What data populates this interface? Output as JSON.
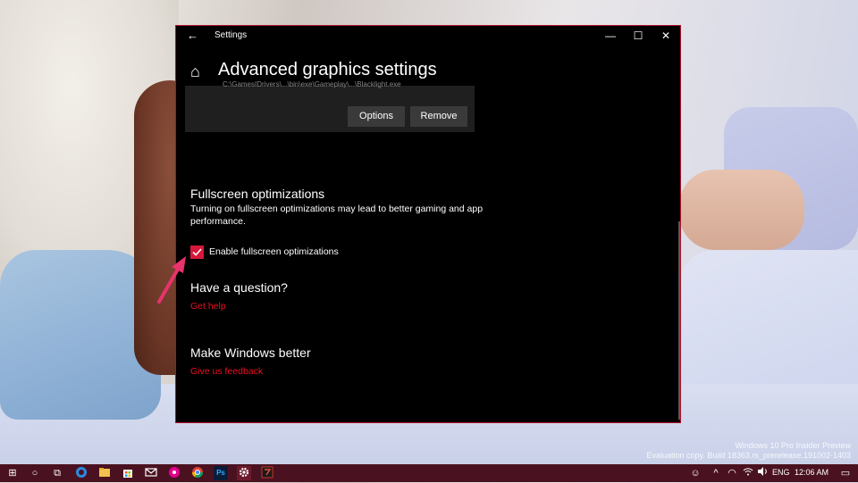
{
  "window": {
    "title": "Settings",
    "back_glyph": "←",
    "minimize_glyph": "—",
    "maximize_glyph": "☐",
    "close_glyph": "✕"
  },
  "page": {
    "home_glyph": "⌂",
    "heading": "Advanced graphics settings"
  },
  "app_card": {
    "path_text": "C:\\GamesIDrivers\\...\\bin\\exe\\Gameplay\\...\\Blacklight.exe",
    "options_label": "Options",
    "remove_label": "Remove"
  },
  "fullscreen": {
    "title": "Fullscreen optimizations",
    "description": "Turning on fullscreen optimizations may lead to better gaming and app performance.",
    "checkbox_label": "Enable fullscreen optimizations",
    "checked": true
  },
  "question": {
    "title": "Have a question?",
    "link": "Get help"
  },
  "feedback": {
    "title": "Make Windows better",
    "link": "Give us feedback"
  },
  "watermark": {
    "line1": "Windows 10 Pro Insider Preview",
    "line2": "Evaluation copy. Build 18363.rs_prerelease.191002-1403"
  },
  "taskbar": {
    "start_glyph": "⊞",
    "search_glyph": "○",
    "taskview_glyph": "⧉",
    "app_icons": [
      "edge-icon",
      "file-explorer-icon",
      "store-icon",
      "mail-icon",
      "groove-icon",
      "chrome-icon",
      "photoshop-icon",
      "settings-icon",
      "game-icon"
    ],
    "ps_label": "Ps",
    "people_glyph": "☺",
    "chevron_glyph": "^",
    "network_glyph": "◠",
    "volume_glyph": "🔊",
    "language": "ENG",
    "time": "12:06 AM",
    "notification_glyph": "▭"
  },
  "colors": {
    "accent": "#e81123",
    "checkbox": "#d6183a",
    "window_border": "#b0132b",
    "taskbar": "#4a1220",
    "arrow": "#e8336d"
  }
}
